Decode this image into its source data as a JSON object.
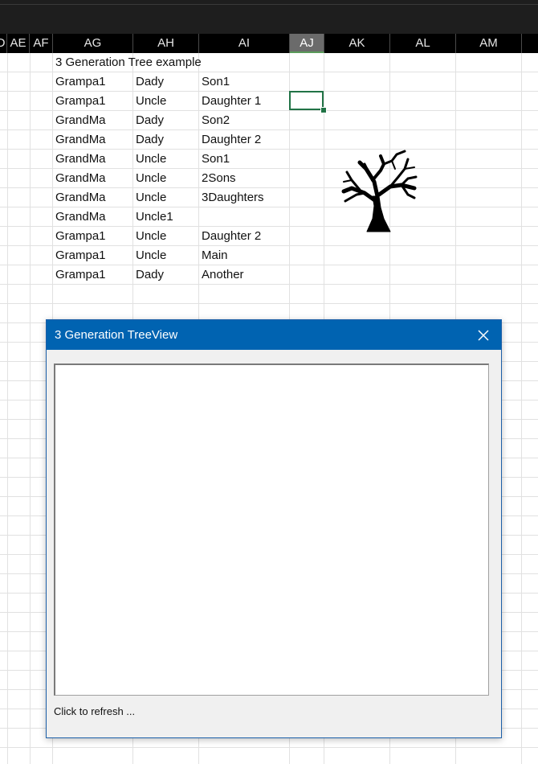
{
  "column_headers": [
    "D",
    "AE",
    "AF",
    "AG",
    "AH",
    "AI",
    "AJ",
    "AK",
    "AL",
    "AM"
  ],
  "selected_column": "AJ",
  "sheet": {
    "title": "3 Generation Tree example",
    "rows": [
      [
        "Grampa1",
        "Dady",
        "Son1"
      ],
      [
        "Grampa1",
        "Uncle",
        "Daughter 1"
      ],
      [
        "GrandMa",
        "Dady",
        "Son2"
      ],
      [
        "GrandMa",
        "Dady",
        "Daughter 2"
      ],
      [
        "GrandMa",
        "Uncle",
        "Son1"
      ],
      [
        "GrandMa",
        "Uncle",
        "2Sons"
      ],
      [
        "GrandMa",
        "Uncle",
        "3Daughters"
      ],
      [
        "GrandMa",
        "Uncle1",
        ""
      ],
      [
        "Grampa1",
        "Uncle",
        "Daughter 2"
      ],
      [
        "Grampa1",
        "Uncle",
        "Main"
      ],
      [
        "Grampa1",
        "Dady",
        "Another"
      ]
    ]
  },
  "icons": {
    "tree": "tree-silhouette-icon",
    "close": "close-icon"
  },
  "colors": {
    "dialog_titlebar": "#0063b1",
    "active_cell_border": "#217346",
    "header_background": "#000000"
  },
  "dialog": {
    "title": "3 Generation TreeView",
    "status": "Click to refresh ..."
  }
}
